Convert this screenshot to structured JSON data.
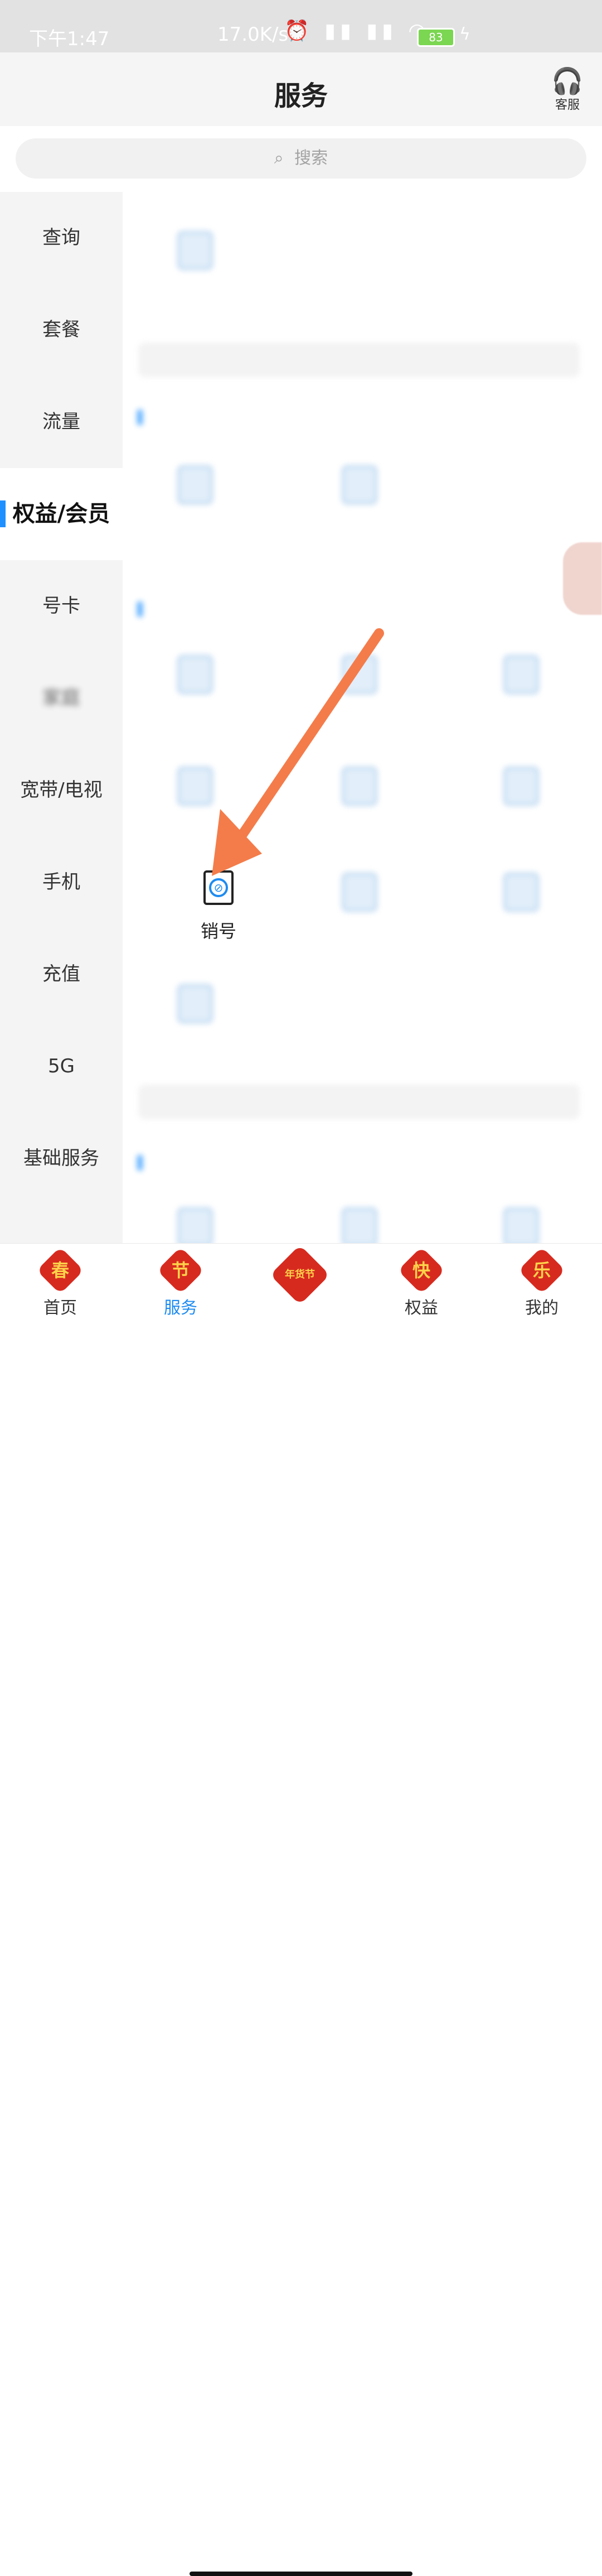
{
  "status_bar": {
    "time": "下午1:47",
    "network_speed": "17.0K/s",
    "battery": "83"
  },
  "header": {
    "title": "服务",
    "customer_service_label": "客服"
  },
  "search": {
    "placeholder": "搜索"
  },
  "sidebar": {
    "items": [
      {
        "label": "查询"
      },
      {
        "label": "套餐"
      },
      {
        "label": "流量"
      },
      {
        "label": "权益/会员",
        "active": true
      },
      {
        "label": "号卡"
      },
      {
        "label": "家庭"
      },
      {
        "label": "宽带/电视"
      },
      {
        "label": "手机"
      },
      {
        "label": "充值"
      },
      {
        "label": "5G"
      },
      {
        "label": "基础服务"
      }
    ]
  },
  "content": {
    "highlighted_item": {
      "label": "销号",
      "icon": "cancel-number-icon"
    }
  },
  "tabbar": {
    "items": [
      {
        "label": "首页",
        "badge": "春"
      },
      {
        "label": "服务",
        "badge": "节",
        "active": true
      },
      {
        "label": "",
        "badge": "年货节"
      },
      {
        "label": "权益",
        "badge": "快"
      },
      {
        "label": "我的",
        "badge": "乐"
      }
    ]
  },
  "annotation": {
    "arrow_color": "#f47c4a"
  },
  "colors": {
    "accent": "#1e8bf0"
  }
}
